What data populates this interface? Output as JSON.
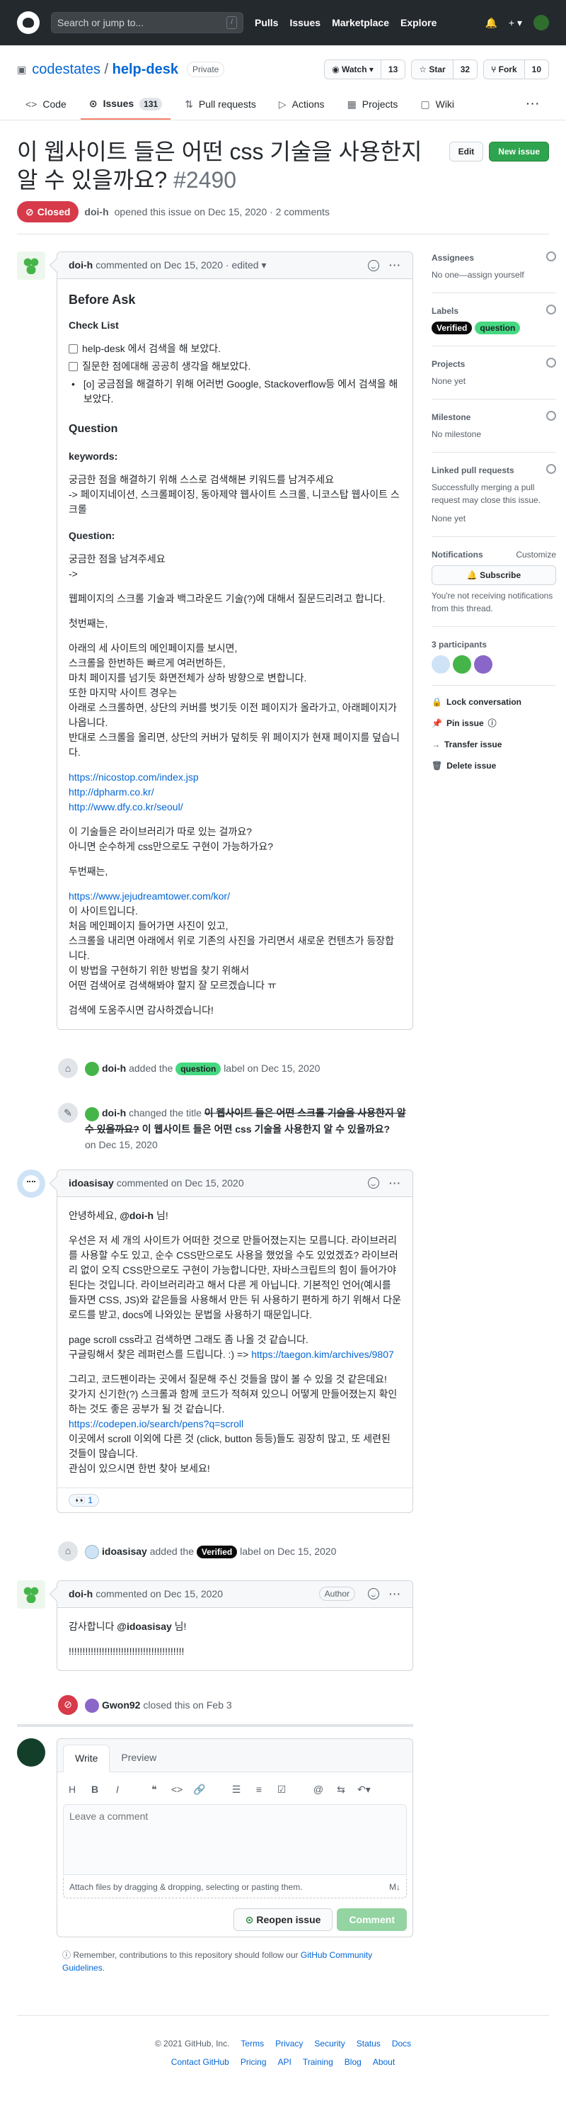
{
  "header": {
    "search_placeholder": "Search or jump to...",
    "slash_key": "/",
    "nav": [
      "Pulls",
      "Issues",
      "Marketplace",
      "Explore"
    ]
  },
  "repo": {
    "owner": "codestates",
    "separator": " / ",
    "name": "help-desk",
    "visibility": "Private",
    "watch_label": "Watch",
    "watch_count": "13",
    "star_label": "Star",
    "star_count": "32",
    "fork_label": "Fork",
    "fork_count": "10",
    "tabs": {
      "code": "Code",
      "issues": "Issues",
      "issues_count": "131",
      "pulls": "Pull requests",
      "actions": "Actions",
      "projects": "Projects",
      "wiki": "Wiki"
    }
  },
  "issue": {
    "title": "이 웹사이트 들은 어떤 css 기술을 사용한지 알 수 있을까요?",
    "number": "#2490",
    "edit_label": "Edit",
    "new_issue_label": "New issue",
    "state": "Closed",
    "author": "doi-h",
    "meta": "opened this issue on Dec 15, 2020 · 2 comments"
  },
  "comment1": {
    "author": "doi-h",
    "meta": "commented on Dec 15, 2020 · edited ▾",
    "h_before_ask": "Before Ask",
    "h_checklist": "Check List",
    "check1": "help-desk 에서 검색을 해 보았다.",
    "check2": "질문한 점에대해 공공히 생각을 해보았다.",
    "check3": "[ο] 궁금점을 해결하기 위해 어러번 Google, Stackoverflow등 에서 검색을 해보았다.",
    "h_question": "Question",
    "h_keywords": "keywords:",
    "kw1": "궁금한 점을 해결하기 위해 스스로 검색해본 키워드를 남겨주세요",
    "kw2": "-> 페이지네이션, 스크롤페이징, 동아제약 웹사이트 스크롤, 니코스탑 웹사이트 스크롤",
    "h_question2": "Question:",
    "q1": "궁금한 점을 남겨주세요",
    "q2": "->",
    "q3": "웹페이지의 스크롤 기술과 백그라운드 기술(?)에 대해서 질문드리려고 합니다.",
    "p_first": "첫번째는,",
    "f1": "아래의 세 사이트의 메인페이지를 보시면,",
    "f2": "스크롤을 한번하든 빠르게 여러번하든,",
    "f3": "마치 페이지를 넘기듯 화면전체가 상하 방향으로 변합니다.",
    "f4": "또한 마지막 사이트 경우는",
    "f5": "아래로 스크롤하면, 상단의 커버를 벗기듯 이전 페이지가 올라가고, 아래페이지가 나옵니다.",
    "f6": "반대로 스크롤을 올리면, 상단의 커버가 덮히듯 위 페이지가 현재 페이지를 덮습니다.",
    "link1": "https://nicostop.com/index.jsp",
    "link2": "http://dpharm.co.kr/",
    "link3": "http://www.dfy.co.kr/seoul/",
    "q4": "이 기술들은 라이브러리가 따로 있는 걸까요?",
    "q5": "아니면 순수하게 css만으로도 구현이 가능하가요?",
    "p_second": "두번째는,",
    "link4": "https://www.jejudreamtower.com/kor/",
    "s1": "이 사이트입니다.",
    "s2": "처음 메인페이지 들어가면 사진이 있고,",
    "s3": "스크롤을 내리면 아래에서 위로 기존의 사진을 가리면서 새로운 컨텐츠가 등장합니다.",
    "s4": "이 방법을 구현하기 위한 방법을 찾기 위해서",
    "s5": "어떤 검색어로 검색해봐야 할지 잘 모르겠습니다 ㅠ",
    "thanks": "검색에 도움주시면 감사하겠습니다!"
  },
  "event_label1": {
    "actor": "doi-h",
    "added": "added the",
    "label": "question",
    "tail": "label on Dec 15, 2020"
  },
  "event_title": {
    "actor": "doi-h",
    "changed": "changed the title",
    "old": "이 웹사이트 들은 어떤 스크롤 기술을 사용한지 알 수 있을까요?",
    "new": "이 웹사이트 들은 어떤 css 기술을 사용한지 알 수 있을까요?",
    "date": "on Dec 15, 2020"
  },
  "comment2": {
    "author": "idoasisay",
    "meta": "commented on Dec 15, 2020",
    "greet_pre": "안녕하세요,",
    "mention": "@doi-h",
    "greet_post": "님!",
    "p1": "우선은 저 세 개의 사이트가 어떠한 것으로 만들어졌는지는 모릅니다. 라이브러리를 사용할 수도 있고, 순수 CSS만으로도 사용을 했었을 수도 있었겠죠? 라이브러리 없이 오직 CSS만으로도 구현이 가능합니다만, 자바스크립트의 힘이 들어가야 된다는 것입니다. 라이브러리라고 해서 다른 게 아닙니다. 기본적인 언어(예시를 들자면 CSS, JS)와 같은들을 사용해서 만든 뒤 사용하기 편하게 하기 위해서 다운로드를 받고, docs에 나와있는 문법을 사용하기 때문입니다.",
    "p2a": "page scroll css라고 검색하면 그래도 좀 나올 것 같습니다.",
    "p2b": "구글링해서 찾은 레퍼런스를 드립니다. :) =>",
    "link1": "https://taegon.kim/archives/9807",
    "p3a": "그리고, 코드펜이라는 곳에서 질문해 주신 것들을 많이 볼 수 있을 것 같은데요!",
    "p3b": "갖가지 신기한(?) 스크롤과 함께 코드가 적혀져 있으니 어떻게 만들어졌는지 확인하는 것도 좋은 공부가 될 것 같습니다.",
    "link2": "https://codepen.io/search/pens?q=scroll",
    "p3c": "이곳에서 scroll 이외에 다른 것 (click, button 등등)들도 굉장히 많고, 또 세련된 것들이 많습니다.",
    "p3d": "관심이 있으시면 한번 찾아 보세요!",
    "reaction": "👀 1"
  },
  "event_label2": {
    "actor": "idoasisay",
    "added": "added the",
    "label": "Verified",
    "tail": "label on Dec 15, 2020"
  },
  "comment3": {
    "author": "doi-h",
    "meta": "commented on Dec 15, 2020",
    "badge": "Author",
    "thanks_pre": "감사합니다",
    "mention": "@idoasisay",
    "thanks_post": "님!",
    "excl": "!!!!!!!!!!!!!!!!!!!!!!!!!!!!!!!!!!!!!!!!!!"
  },
  "event_closed": {
    "actor": "Gwon92",
    "text": "closed this on Feb 3"
  },
  "newcomment": {
    "tab_write": "Write",
    "tab_preview": "Preview",
    "placeholder": "Leave a comment",
    "attach": "Attach files by dragging & dropping, selecting or pasting them.",
    "reopen": "Reopen issue",
    "comment": "Comment",
    "tip_pre": "Remember, contributions to this repository should follow our",
    "tip_link": "GitHub Community Guidelines",
    "tip_post": "."
  },
  "sidebar": {
    "assignees_h": "Assignees",
    "assignees_v": "No one—assign yourself",
    "labels_h": "Labels",
    "label_verified": "Verified",
    "label_question": "question",
    "projects_h": "Projects",
    "projects_v": "None yet",
    "milestone_h": "Milestone",
    "milestone_v": "No milestone",
    "linked_h": "Linked pull requests",
    "linked_desc": "Successfully merging a pull request may close this issue.",
    "linked_v": "None yet",
    "notif_h": "Notifications",
    "notif_customize": "Customize",
    "subscribe": "Subscribe",
    "notif_desc": "You're not receiving notifications from this thread.",
    "participants_h": "3 participants",
    "lock": "Lock conversation",
    "pin": "Pin issue",
    "transfer": "Transfer issue",
    "delete": "Delete issue"
  },
  "footer": {
    "copyright": "© 2021 GitHub, Inc.",
    "row1": [
      "Terms",
      "Privacy",
      "Security",
      "Status",
      "Docs"
    ],
    "row2": [
      "Contact GitHub",
      "Pricing",
      "API",
      "Training",
      "Blog",
      "About"
    ]
  }
}
